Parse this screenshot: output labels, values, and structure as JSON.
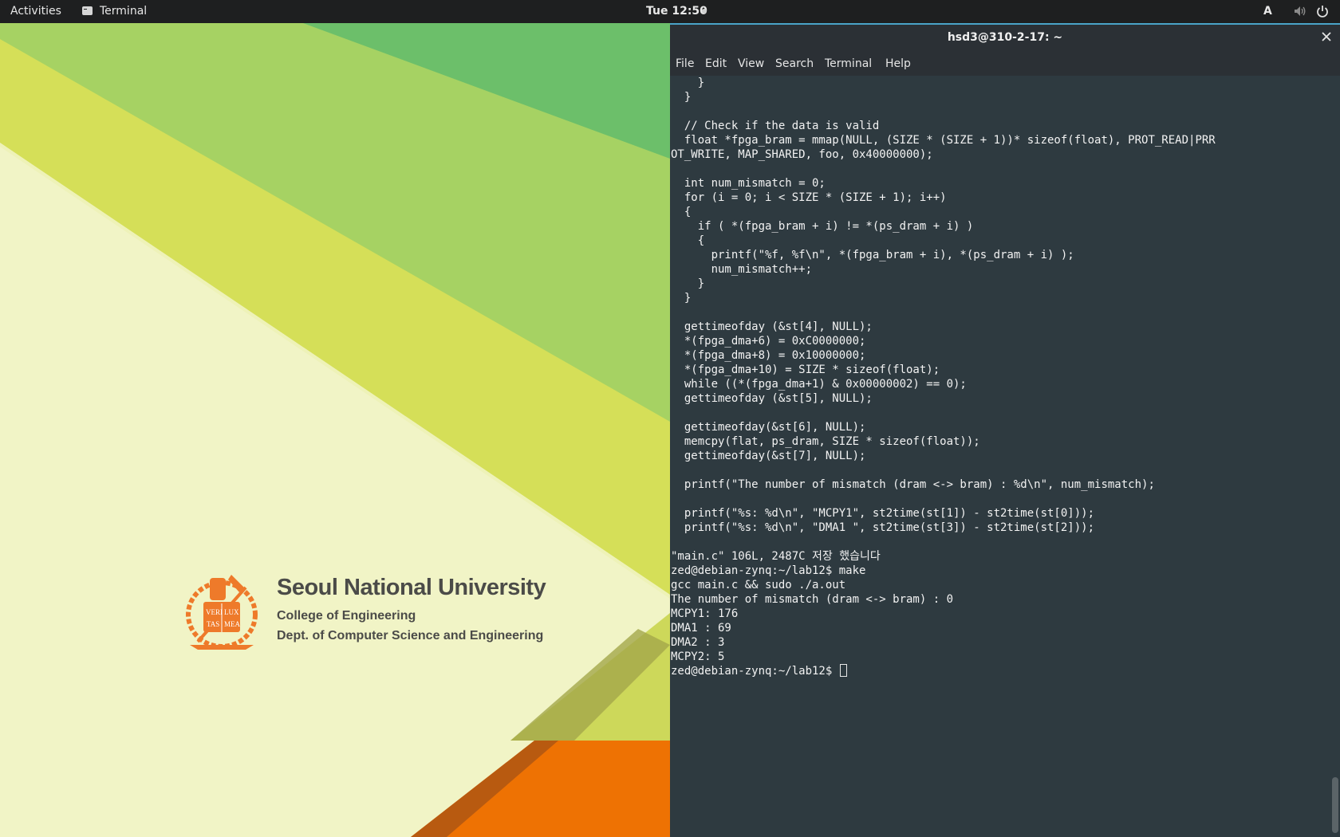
{
  "topbar": {
    "activities": "Activities",
    "app_name": "Terminal",
    "clock": "Tue 12:50",
    "input_indicator": "A"
  },
  "desktop": {
    "university": "Seoul National University",
    "college": "College of Engineering",
    "department": "Dept. of Computer Science and Engineering",
    "seal_text": [
      "VERI",
      "LUX",
      "TAS",
      "MEA"
    ],
    "colors": {
      "orange": "#ee7203",
      "lime": "#d8e25a",
      "green": "#6cbf6a",
      "cream": "#f3f5cf"
    }
  },
  "terminal": {
    "title": "hsd3@310-2-17: ~",
    "menu": [
      "File",
      "Edit",
      "View",
      "Search",
      "Terminal",
      "Help"
    ],
    "lines": [
      "    }",
      "  }",
      "",
      "  // Check if the data is valid",
      "  float *fpga_bram = mmap(NULL, (SIZE * (SIZE + 1))* sizeof(float), PROT_READ|PRR",
      "OT_WRITE, MAP_SHARED, foo, 0x40000000);",
      "",
      "  int num_mismatch = 0;",
      "  for (i = 0; i < SIZE * (SIZE + 1); i++)",
      "  {",
      "    if ( *(fpga_bram + i) != *(ps_dram + i) )",
      "    {",
      "      printf(\"%f, %f\\n\", *(fpga_bram + i), *(ps_dram + i) );",
      "      num_mismatch++;",
      "    }",
      "  }",
      "",
      "  gettimeofday (&st[4], NULL);",
      "  *(fpga_dma+6) = 0xC0000000;",
      "  *(fpga_dma+8) = 0x10000000;",
      "  *(fpga_dma+10) = SIZE * sizeof(float);",
      "  while ((*(fpga_dma+1) & 0x00000002) == 0);",
      "  gettimeofday (&st[5], NULL);",
      "",
      "  gettimeofday(&st[6], NULL);",
      "  memcpy(flat, ps_dram, SIZE * sizeof(float));",
      "  gettimeofday(&st[7], NULL);",
      "",
      "  printf(\"The number of mismatch (dram <-> bram) : %d\\n\", num_mismatch);",
      "",
      "  printf(\"%s: %d\\n\", \"MCPY1\", st2time(st[1]) - st2time(st[0]));",
      "  printf(\"%s: %d\\n\", \"DMA1 \", st2time(st[3]) - st2time(st[2]));",
      "",
      "\"main.c\" 106L, 2487C 저장 했습니다",
      "zed@debian-zynq:~/lab12$ make",
      "gcc main.c && sudo ./a.out",
      "The number of mismatch (dram <-> bram) : 0",
      "MCPY1: 176",
      "DMA1 : 69",
      "DMA2 : 3",
      "MCPY2: 5"
    ],
    "prompt": "zed@debian-zynq:~/lab12$ "
  }
}
